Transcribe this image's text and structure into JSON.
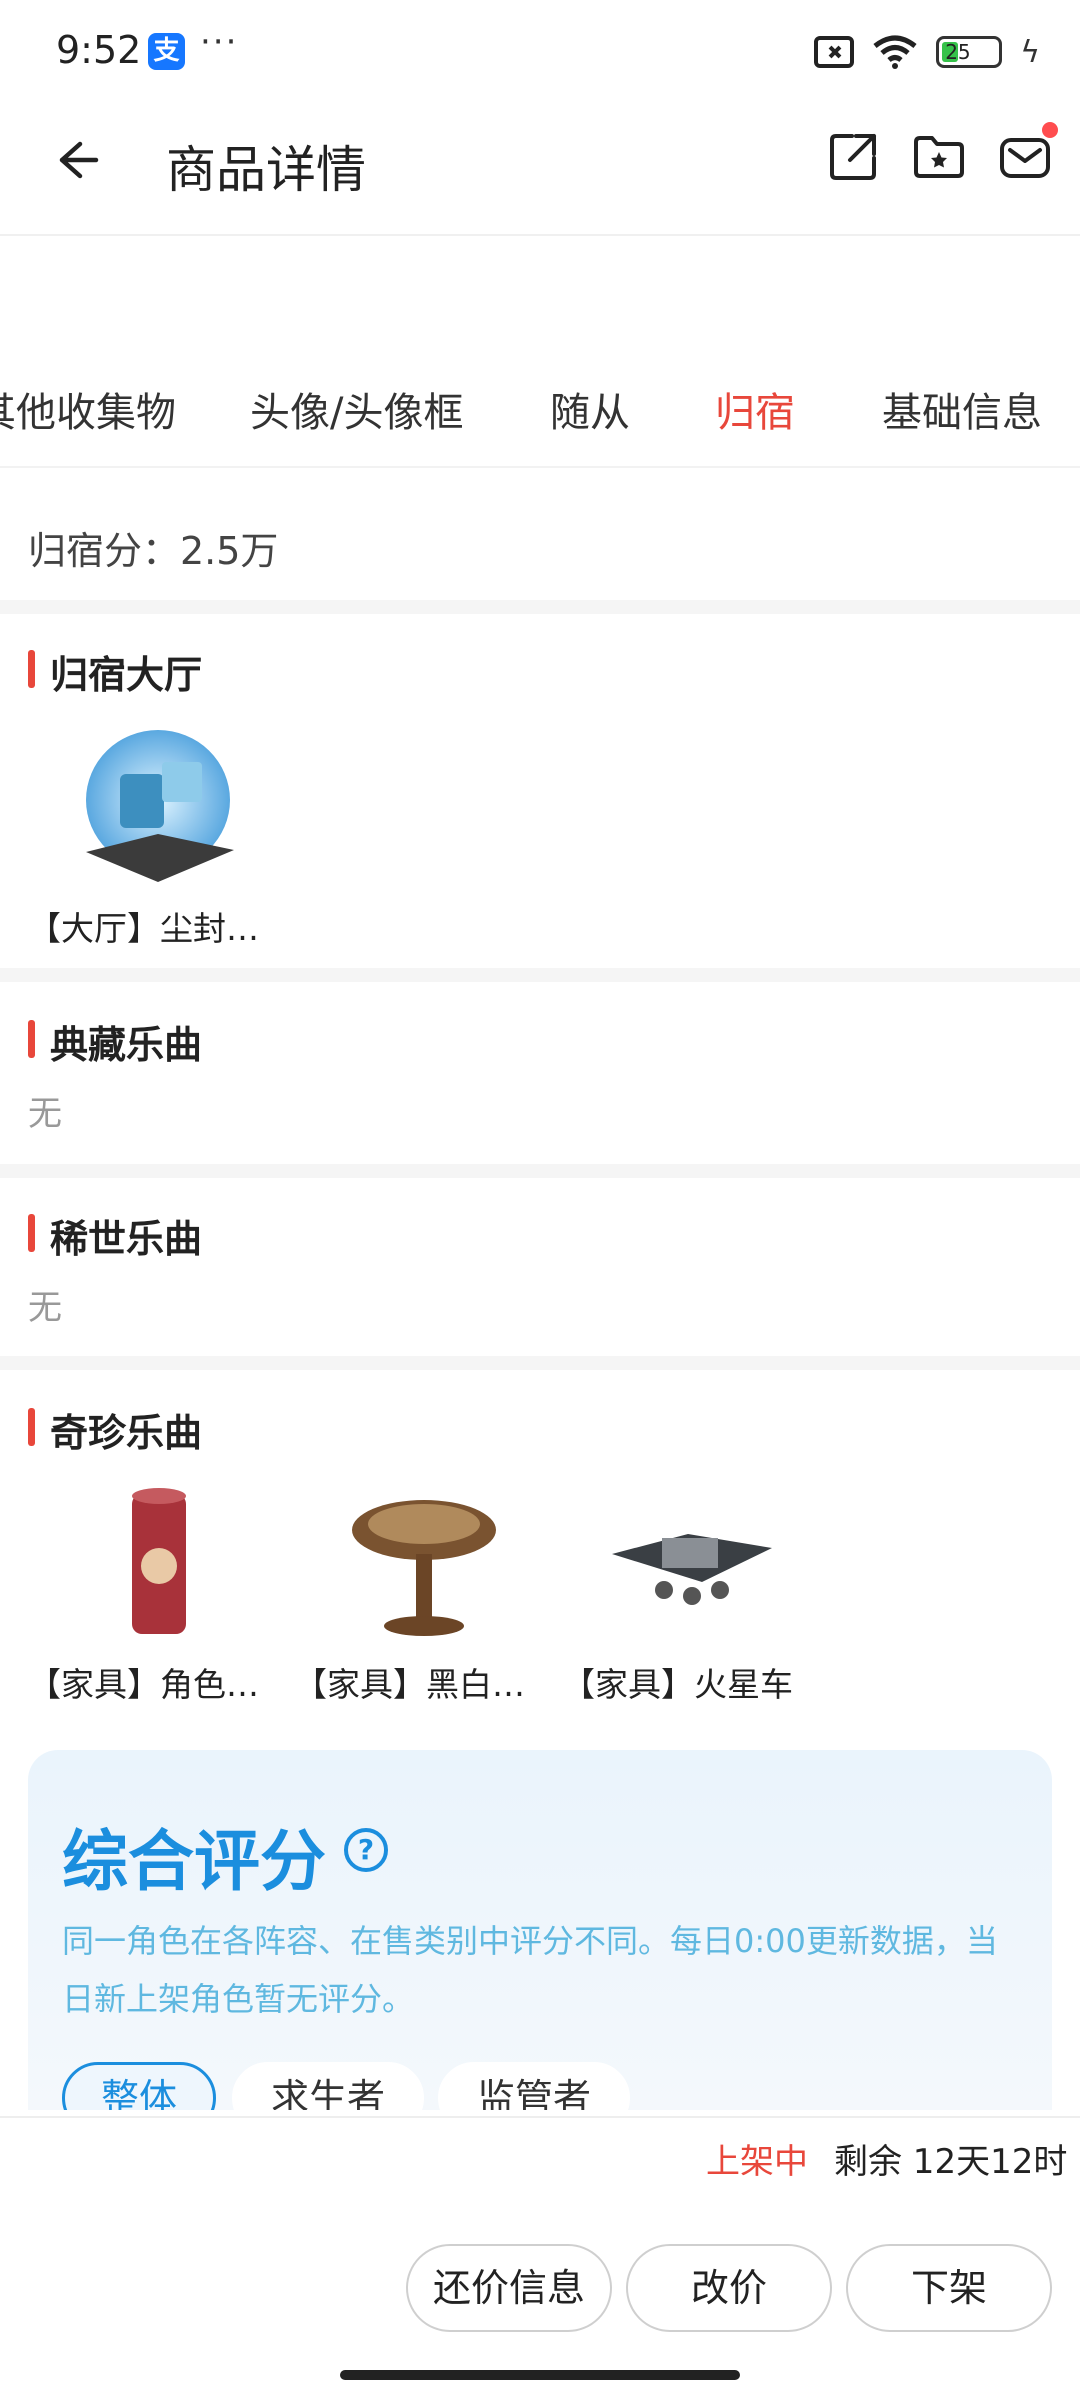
{
  "status_bar": {
    "time": "9:52",
    "alipay": "支",
    "more": "···",
    "battery": "25"
  },
  "nav": {
    "title": "商品详情"
  },
  "tabs": [
    {
      "label": "其他收集物"
    },
    {
      "label": "头像/头像框"
    },
    {
      "label": "随从"
    },
    {
      "label": "归宿",
      "active": true
    },
    {
      "label": "基础信息"
    }
  ],
  "score": {
    "text": "归宿分：2.5万"
  },
  "sections": {
    "hall": {
      "title": "归宿大厅",
      "items": [
        {
          "name": "【大厅】尘封…"
        }
      ]
    },
    "classic_music": {
      "title": "典藏乐曲",
      "empty": "无"
    },
    "rare_music": {
      "title": "稀世乐曲",
      "empty": "无"
    },
    "treasure_music": {
      "title": "奇珍乐曲",
      "items": [
        {
          "name": "【家具】角色…"
        },
        {
          "name": "【家具】黑白…"
        },
        {
          "name": "【家具】火星车"
        }
      ]
    }
  },
  "rating": {
    "title": "综合评分",
    "help": "?",
    "desc": "同一角色在各阵容、在售类别中评分不同。每日0:00更新数据，当日新上架角色暂无评分。",
    "pills": [
      {
        "label": "整体",
        "active": true
      },
      {
        "label": "求生者"
      },
      {
        "label": "监管者"
      }
    ]
  },
  "listing": {
    "status": "上架中",
    "remaining": "剩余 12天12时"
  },
  "actions": {
    "counter_offer": "还价信息",
    "change_price": "改价",
    "take_down": "下架"
  },
  "colors": {
    "accent_red": "#e8473b",
    "accent_blue": "#1b8ede"
  }
}
